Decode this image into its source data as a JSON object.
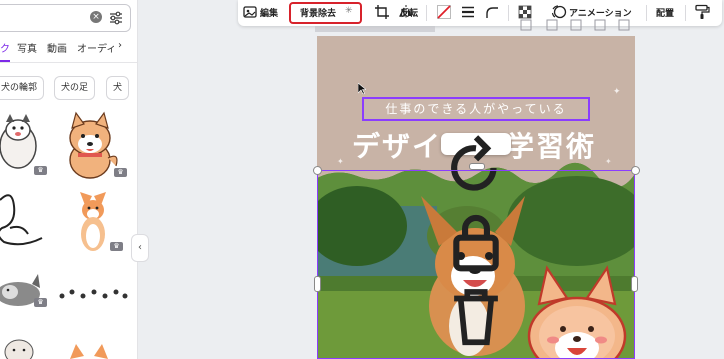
{
  "sidebar": {
    "tabs": [
      "ク",
      "写真",
      "動画",
      "オーディ"
    ],
    "chips": [
      "犬の輪郭",
      "犬の足",
      "犬"
    ]
  },
  "toolbar": {
    "edit_label": "編集",
    "bg_remove_label": "背景除去",
    "flip_label": "反転",
    "animation_label": "アニメーション",
    "position_label": "配置"
  },
  "canvas": {
    "text_box": "仕事のできる人がやっている",
    "title_text": "デザイン学習術",
    "title_left": "デザイ",
    "title_right": "学習術"
  },
  "colors": {
    "accent": "#8b3dff",
    "highlight": "#d7222b",
    "page_bg": "#c8b3a6"
  }
}
